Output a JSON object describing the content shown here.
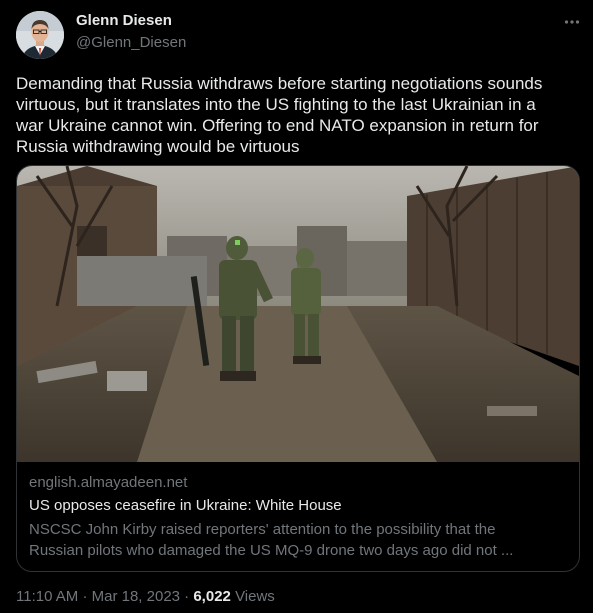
{
  "author": {
    "name": "Glenn Diesen",
    "handle": "@Glenn_Diesen"
  },
  "tweet": {
    "lines": [
      "Demanding that Russia withdraws before starting negotiations sounds",
      "virtuous, but it translates into the US fighting to the last Ukrainian in a",
      "war Ukraine cannot win. Offering to end NATO expansion in return for",
      "Russia withdrawing would be virtuous"
    ]
  },
  "link_card": {
    "domain": "english.almayadeen.net",
    "title": "US opposes ceasefire in Ukraine: White House",
    "description_lines": [
      "NSCSC John Kirby raised reporters' attention to the possibility that the",
      "Russian pilots who damaged the US MQ-9 drone two days ago did not ..."
    ]
  },
  "meta": {
    "time": "11:10 AM",
    "separator": "·",
    "date": "Mar 18, 2023",
    "views_count": "6,022",
    "views_label": "Views"
  },
  "icons": {
    "more": "more-horizontal-icon"
  },
  "colors": {
    "background": "#000000",
    "text_primary": "#e7e9ea",
    "text_secondary": "#71767b",
    "border": "#2f3336"
  }
}
